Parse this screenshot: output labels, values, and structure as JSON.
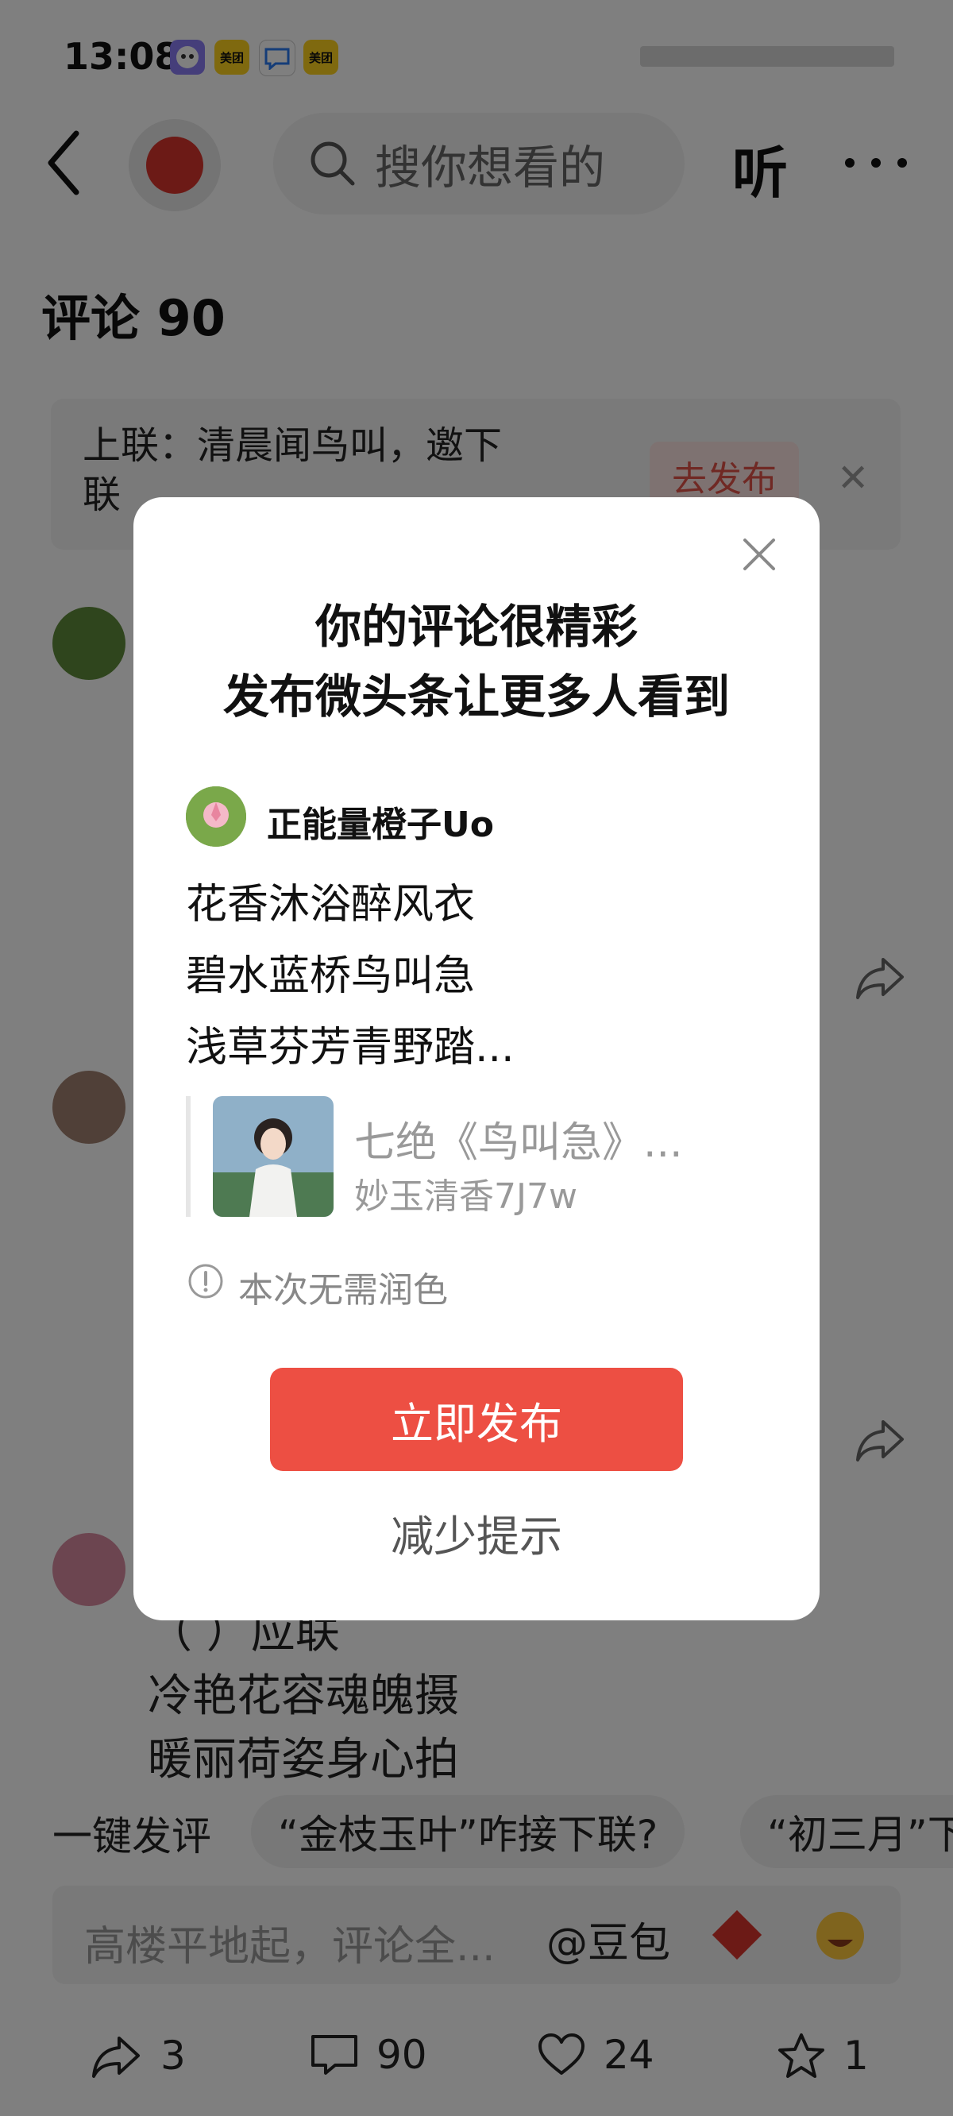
{
  "status_bar": {
    "time": "13:08",
    "apps": [
      {
        "name": "doubao-icon",
        "label": "",
        "color": "#8a7cf5"
      },
      {
        "name": "meituan-icon",
        "label": "美团",
        "color": "#ffd21f"
      },
      {
        "name": "message-icon",
        "label": "",
        "color": "#ffffff"
      },
      {
        "name": "meituan-icon-2",
        "label": "美团",
        "color": "#ffd21f"
      }
    ]
  },
  "header": {
    "search_placeholder": "搜你想看的",
    "listen_label": "听"
  },
  "comments": {
    "title": "评论 90",
    "couplet_prompt": "上联：清晨闻鸟叫，邀下联",
    "couplet_publish": "去发布",
    "third_comment_lines": [
      "（ ）应联",
      "冷艳花容魂魄摄",
      "暖丽荷姿身心拍"
    ]
  },
  "quick_comment": {
    "label": "一键发评",
    "chips": [
      "“金枝玉叶”咋接下联?",
      "“初三月”下"
    ]
  },
  "comment_input": {
    "placeholder": "高楼平地起，评论全...",
    "mention": "@豆包"
  },
  "bottom_actions": {
    "share_count": "3",
    "comment_count": "90",
    "like_count": "24",
    "favorite_count": "1"
  },
  "modal": {
    "title_line1": "你的评论很精彩",
    "title_line2": "发布微头条让更多人看到",
    "author": "正能量橙子Uo",
    "poem_lines": [
      "花香沐浴醉风衣",
      "碧水蓝桥鸟叫急",
      "浅草芬芳青野踏..."
    ],
    "quote_title": "七绝《鸟叫急》...",
    "quote_author": "妙玉清香7J7w",
    "info": "本次无需润色",
    "primary_button": "立即发布",
    "secondary_button": "减少提示"
  },
  "colors": {
    "accent": "#ed4f43",
    "overlay": "rgba(0,0,0,0.5)"
  }
}
